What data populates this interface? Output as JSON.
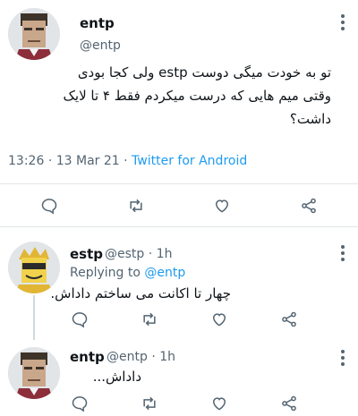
{
  "main_tweet": {
    "name": "entp",
    "handle": "@entp",
    "text_line1": "تو به خودت میگی دوست estp ولی کجا بودی",
    "text_line2": "وقتی میم هایی که درست میکردم فقط ۴ تا لایک",
    "text_line3": "داشت؟",
    "time": "13:26",
    "sep": "·",
    "date": "13 Mar 21",
    "source": "Twitter for Android"
  },
  "reply1": {
    "name": "estp",
    "handle": "@estp",
    "sep": "·",
    "age": "1h",
    "replying_label": "Replying to",
    "replying_to": "@entp",
    "text": "چهار تا اکانت می ساختم داداش."
  },
  "reply2": {
    "name": "entp",
    "handle": "@entp",
    "sep": "·",
    "age": "1h",
    "text": "داداش..."
  },
  "icons": {
    "reply": "comment-icon",
    "retweet": "retweet-icon",
    "like": "heart-icon",
    "share": "share-icon",
    "more": "more-vertical-icon"
  },
  "colors": {
    "link": "#1d9bf0",
    "secondary_text": "#536471",
    "divider": "#e1e5e8"
  }
}
